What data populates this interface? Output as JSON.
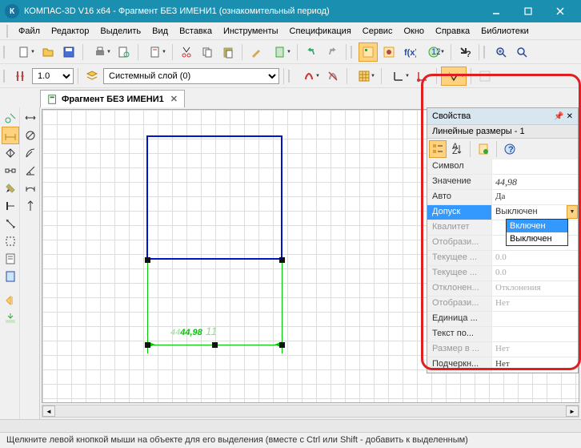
{
  "title": "КОМПАС-3D V16  x64 - Фрагмент БЕЗ ИМЕНИ1 (ознакомительный период)",
  "menu": {
    "file": "Файл",
    "editor": "Редактор",
    "select": "Выделить",
    "view": "Вид",
    "insert": "Вставка",
    "tools": "Инструменты",
    "spec": "Спецификация",
    "service": "Сервис",
    "window": "Окно",
    "help": "Справка",
    "libs": "Библиотеки"
  },
  "toolbar2": {
    "scale": "1.0",
    "layer": "Системный слой (0)"
  },
  "doctab": {
    "label": "Фрагмент БЕЗ ИМЕНИ1"
  },
  "drawing": {
    "dim_value": "44,98",
    "dim_prefix": "44",
    "dim_suffix": "11"
  },
  "props": {
    "title": "Свойства",
    "subtitle": "Линейные размеры - 1",
    "rows": [
      {
        "label": "Символ",
        "value": ""
      },
      {
        "label": "Значение",
        "value": "44,98"
      },
      {
        "label": "Авто",
        "value": "Да"
      },
      {
        "label": "Допуск",
        "value": "Выключен"
      },
      {
        "label": "Квалитет",
        "value": ""
      },
      {
        "label": "Отобрази...",
        "value": ""
      },
      {
        "label": "Текущее ...",
        "value": "0.0"
      },
      {
        "label": "Текущее ...",
        "value": "0.0"
      },
      {
        "label": "Отклонен...",
        "value": "Отклонения"
      },
      {
        "label": "Отобрази...",
        "value": "Нет"
      },
      {
        "label": "Единица ...",
        "value": ""
      },
      {
        "label": "Текст по...",
        "value": ""
      },
      {
        "label": "Размер в ...",
        "value": "Нет"
      },
      {
        "label": "Подчеркн...",
        "value": "Нет"
      }
    ],
    "dropdown": {
      "opt1": "Включен",
      "opt2": "Выключен"
    }
  },
  "status": "Щелкните левой кнопкой мыши на объекте для его выделения (вместе с Ctrl или Shift - добавить к выделенным)"
}
